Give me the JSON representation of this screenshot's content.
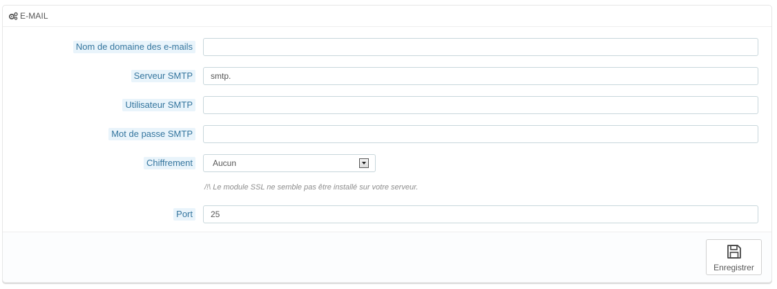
{
  "panel": {
    "title": "E-MAIL",
    "title_icon": "gears-icon"
  },
  "fields": {
    "domain": {
      "label": "Nom de domaine des e-mails",
      "value": ""
    },
    "smtp_server": {
      "label": "Serveur SMTP",
      "value": "smtp."
    },
    "smtp_user": {
      "label": "Utilisateur SMTP",
      "value": ""
    },
    "smtp_password": {
      "label": "Mot de passe SMTP",
      "value": ""
    },
    "encryption": {
      "label": "Chiffrement",
      "selected": "Aucun",
      "help": "/!\\ Le module SSL ne semble pas être installé sur votre serveur."
    },
    "port": {
      "label": "Port",
      "value": "25"
    }
  },
  "footer": {
    "save_label": "Enregistrer",
    "save_icon": "floppy-disk-icon"
  },
  "colors": {
    "label_bg": "#e9f4fb",
    "label_text": "#34759e",
    "input_border": "#c7d6db",
    "panel_border": "#e6e6e6"
  }
}
